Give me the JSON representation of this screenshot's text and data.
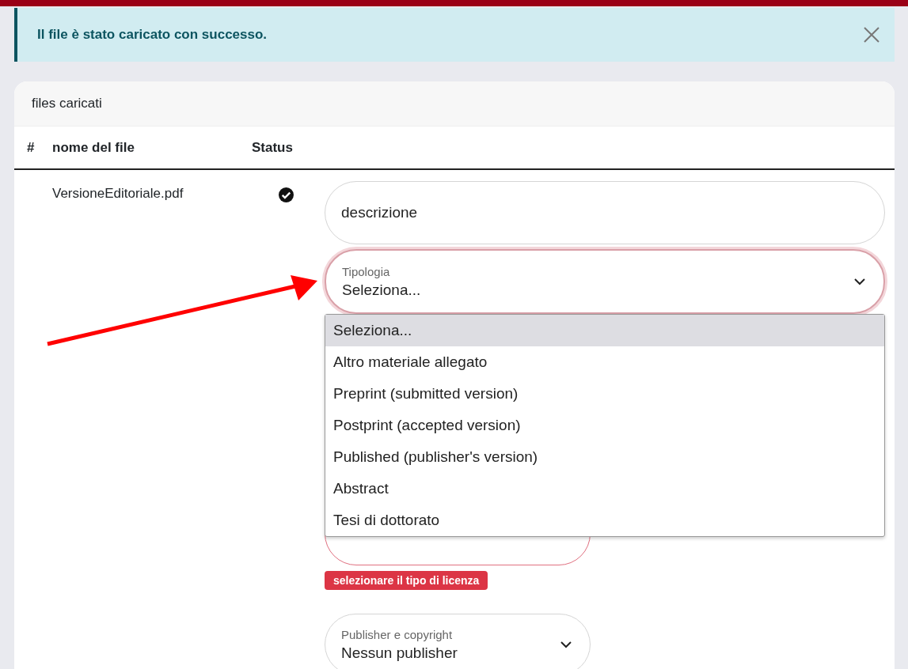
{
  "alert": {
    "message": "Il file è stato caricato con successo."
  },
  "card": {
    "title": "files caricati"
  },
  "table": {
    "columns": [
      "#",
      "nome del file",
      "Status"
    ],
    "rows": [
      {
        "index": "",
        "file_name": "VersioneEditoriale.pdf",
        "uploaded": true,
        "description": {
          "placeholder": "descrizione"
        },
        "type_select": {
          "label": "Tipologia",
          "value": "Seleziona...",
          "invalid": true,
          "expanded": true,
          "options": [
            {
              "label": "Seleziona...",
              "selected": true
            },
            {
              "label": "Altro materiale allegato",
              "selected": false
            },
            {
              "label": "Preprint (submitted version)",
              "selected": false
            },
            {
              "label": "Postprint (accepted version)",
              "selected": false
            },
            {
              "label": "Published (publisher's version)",
              "selected": false
            },
            {
              "label": "Abstract",
              "selected": false
            },
            {
              "label": "Tesi di dottorato",
              "selected": false
            }
          ]
        },
        "license_select": {
          "invalid": true,
          "error": "selezionare il tipo di licenza"
        },
        "publisher_select": {
          "label": "Publisher e copyright",
          "value": "Nessun publisher",
          "invalid": false
        }
      }
    ]
  }
}
